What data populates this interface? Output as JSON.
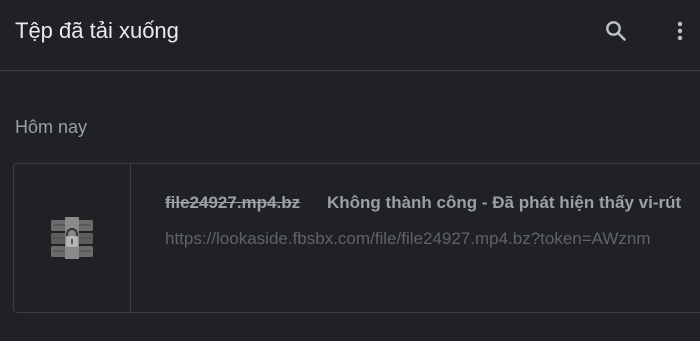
{
  "header": {
    "title": "Tệp đã tải xuống",
    "search_icon": "search-icon",
    "more_icon": "more-vert-icon"
  },
  "section": {
    "label": "Hôm nay"
  },
  "download": {
    "filename": "file24927.mp4.bz",
    "status": "Không thành công - Đã phát hiện thấy vi-rút",
    "url": "https://lookaside.fbsbx.com/file/file24927.mp4.bz?token=AWznm",
    "icon": "archive-file-icon"
  },
  "colors": {
    "background": "#202124",
    "text_primary": "#e8eaed",
    "text_secondary": "#9aa0a6",
    "divider": "#3c4043"
  }
}
